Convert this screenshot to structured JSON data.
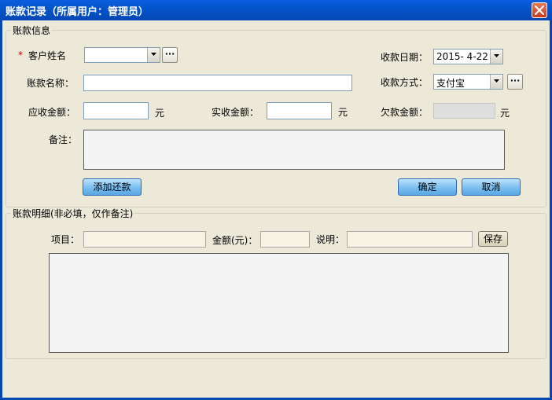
{
  "window": {
    "title": "账款记录（所属用户：管理员）",
    "close_icon": "close-icon",
    "accent": "#0347B5"
  },
  "info_group": {
    "legend": "账款信息",
    "required_mark": "*",
    "customer_label": "客户姓名",
    "customer_value": "",
    "date_label": "收款日期：",
    "date_value": "2015- 4-22",
    "account_name_label": "账款名称：",
    "account_name_value": "",
    "payment_method_label": "收款方式：",
    "payment_method_value": "支付宝",
    "receivable_label": "应收金额：",
    "receivable_value": "",
    "received_label": "实收金额：",
    "received_value": "",
    "owed_label": "欠款金额：",
    "owed_value": "",
    "unit": "元",
    "remark_label": "备注：",
    "remark_value": "",
    "ellipsis": "···",
    "add_repay_button": "添加还款",
    "confirm_button": "确定",
    "cancel_button": "取消"
  },
  "detail_group": {
    "legend": "账款明细(非必填，仅作备注)",
    "item_label": "项目：",
    "item_value": "",
    "amount_label": "金额(元)：",
    "amount_value": "",
    "desc_label": "说明：",
    "desc_value": "",
    "save_button": "保存"
  }
}
